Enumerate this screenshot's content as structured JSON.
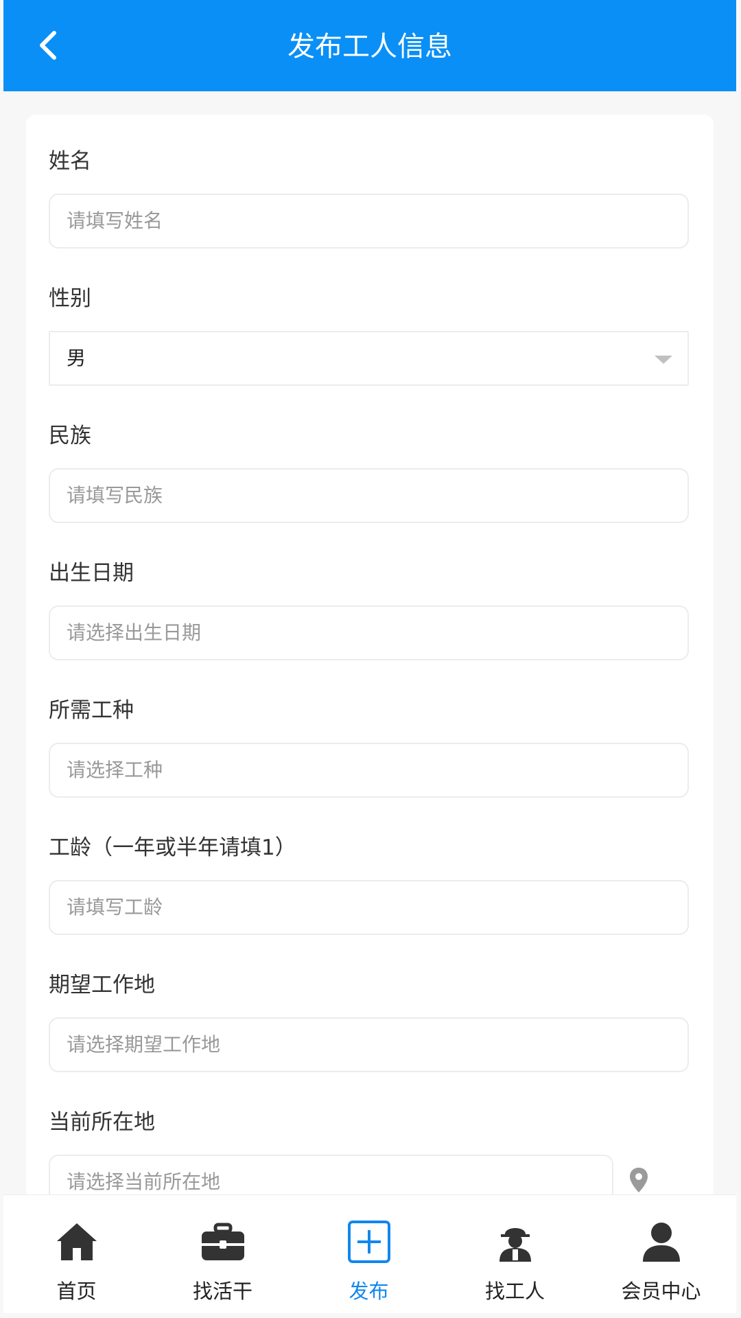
{
  "header": {
    "title": "发布工人信息",
    "bg_color": "#0a8ff6",
    "back_icon": "chevron-left-icon"
  },
  "form": {
    "fields": [
      {
        "label": "姓名",
        "placeholder": "请填写姓名",
        "value": ""
      },
      {
        "label": "性别",
        "value": "男",
        "type": "select"
      },
      {
        "label": "民族",
        "placeholder": "请填写民族",
        "value": ""
      },
      {
        "label": "出生日期",
        "placeholder": "请选择出生日期",
        "value": ""
      },
      {
        "label": "所需工种",
        "placeholder": "请选择工种",
        "value": ""
      },
      {
        "label": "工龄（一年或半年请填1）",
        "placeholder": "请填写工龄",
        "value": ""
      },
      {
        "label": "期望工作地",
        "placeholder": "请选择期望工作地",
        "value": ""
      },
      {
        "label": "当前所在地",
        "placeholder": "请选择当前所在地",
        "value": ""
      }
    ],
    "location_icon": "map-pin-icon"
  },
  "tabbar": {
    "active_color": "#1187ee",
    "items": [
      {
        "label": "首页",
        "icon": "home-icon"
      },
      {
        "label": "找活干",
        "icon": "toolbox-icon"
      },
      {
        "label": "发布",
        "icon": "plus-square-icon",
        "active": true
      },
      {
        "label": "找工人",
        "icon": "worker-icon"
      },
      {
        "label": "会员中心",
        "icon": "user-icon"
      }
    ]
  }
}
